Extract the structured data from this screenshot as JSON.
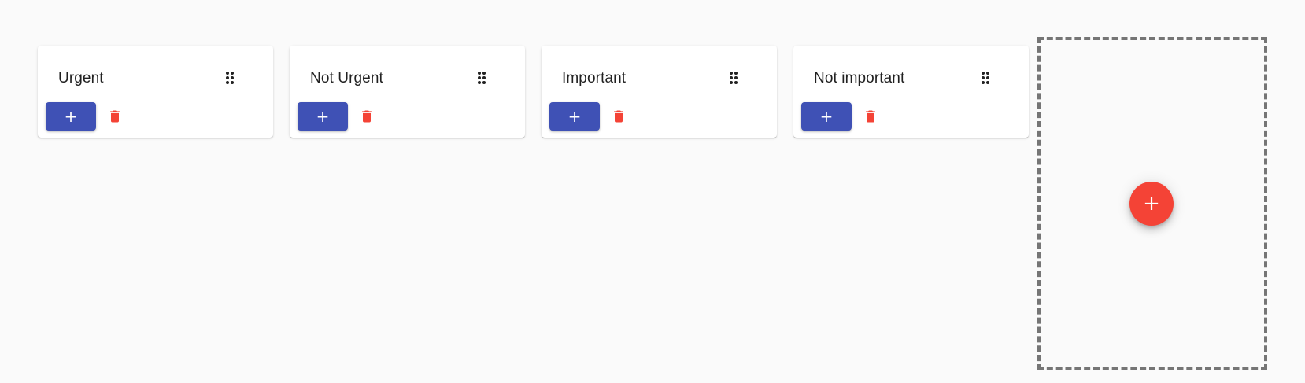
{
  "columns": [
    {
      "title": "Urgent",
      "add_label": "+"
    },
    {
      "title": "Not Urgent",
      "add_label": "+"
    },
    {
      "title": "Important",
      "add_label": "+"
    },
    {
      "title": "Not important",
      "add_label": "+"
    }
  ],
  "new_column": {
    "add_label": "+"
  },
  "colors": {
    "primary": "#3f51b5",
    "warn": "#f44336",
    "background": "#fafafa",
    "dashed_border": "#757575"
  },
  "icons": {
    "drag": "drag-indicator-icon",
    "delete": "trash-icon",
    "add": "plus-icon"
  }
}
